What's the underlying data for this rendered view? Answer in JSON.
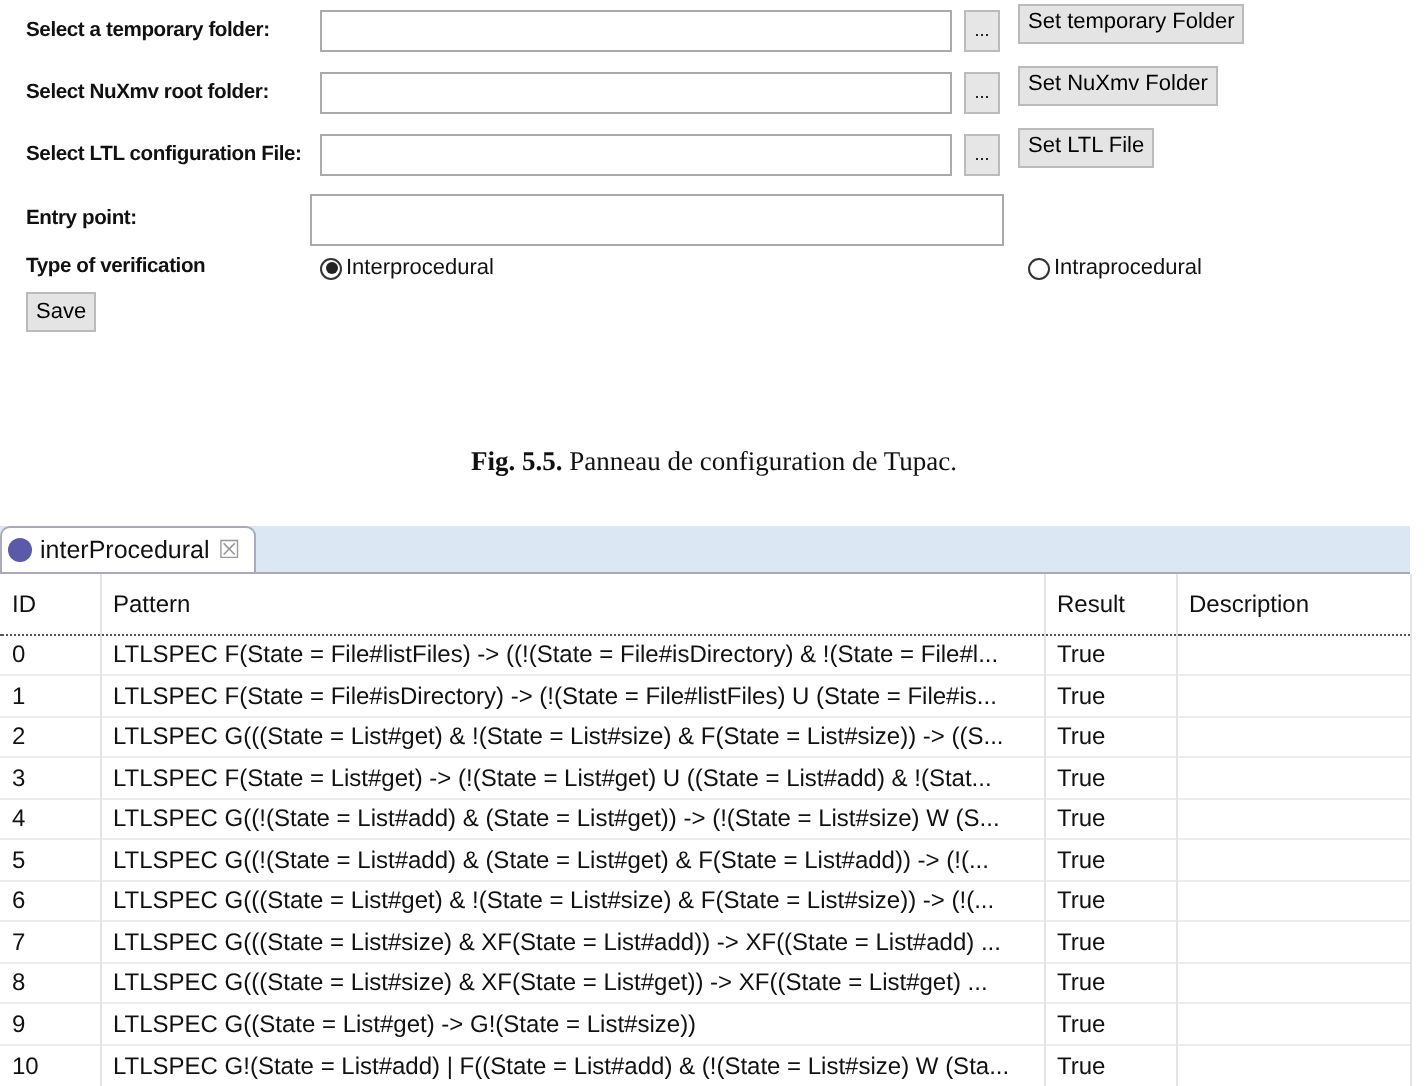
{
  "config_panel": {
    "fields": [
      {
        "label": "Select a temporary folder:",
        "kind": "path",
        "browse": "...",
        "button": "Set temporary Folder"
      },
      {
        "label": "Select NuXmv root folder:",
        "kind": "path",
        "browse": "...",
        "button": "Set NuXmv Folder"
      },
      {
        "label": "Select LTL configuration File:",
        "kind": "path",
        "browse": "...",
        "button": "Set LTL File"
      },
      {
        "label": "Entry point:",
        "kind": "text"
      }
    ],
    "verification": {
      "label": "Type of verification",
      "options": [
        {
          "label": "Interprocedural",
          "selected": true
        },
        {
          "label": "Intraprocedural",
          "selected": false
        }
      ]
    },
    "save_button": "Save"
  },
  "caption": "**Fig. 5.5.** Panneau de configuration de Tupac.",
  "editor": {
    "tab": {
      "title": "interProcedural",
      "close": "☒"
    },
    "table": {
      "columns": [
        "ID",
        "Pattern",
        "Result",
        "Description"
      ],
      "rows": [
        {
          "id": "0",
          "pattern": "LTLSPEC F(State = File#listFiles) -> ((!(State = File#isDirectory) & !(State = File#l...",
          "result": "True",
          "focused": true
        },
        {
          "id": "1",
          "pattern": "LTLSPEC F(State = File#isDirectory) -> (!(State = File#listFiles) U (State = File#is...",
          "result": "True",
          "focused": false
        },
        {
          "id": "2",
          "pattern": "LTLSPEC G(((State = List#get) & !(State = List#size) & F(State = List#size)) -> ((S...",
          "result": "True",
          "focused": false
        },
        {
          "id": "3",
          "pattern": "LTLSPEC F(State = List#get) -> (!(State = List#get) U ((State = List#add) & !(Stat...",
          "result": "True",
          "focused": false
        },
        {
          "id": "4",
          "pattern": "LTLSPEC G((!(State = List#add) & (State = List#get)) -> (!(State = List#size) W (S...",
          "result": "True",
          "focused": false
        },
        {
          "id": "5",
          "pattern": "LTLSPEC G((!(State = List#add) & (State = List#get) & F(State = List#add)) -> (!(...",
          "result": "True",
          "focused": false
        },
        {
          "id": "6",
          "pattern": "LTLSPEC G(((State = List#get) & !(State = List#size) & F(State = List#size)) -> (!(...",
          "result": "True",
          "focused": false
        },
        {
          "id": "7",
          "pattern": "LTLSPEC G(((State = List#size) & XF(State = List#add)) -> XF((State = List#add) ...",
          "result": "True",
          "focused": false
        },
        {
          "id": "8",
          "pattern": "LTLSPEC G(((State = List#size) & XF(State = List#get)) -> XF((State = List#get) ...",
          "result": "True",
          "focused": false
        },
        {
          "id": "9",
          "pattern": "LTLSPEC G((State = List#get) -> G!(State = List#size))",
          "result": "True",
          "focused": false
        },
        {
          "id": "10",
          "pattern": "LTLSPEC G!(State = List#add) | F((State = List#add) & (!(State = List#size) W (Sta...",
          "result": "True",
          "focused": false
        }
      ]
    }
  }
}
